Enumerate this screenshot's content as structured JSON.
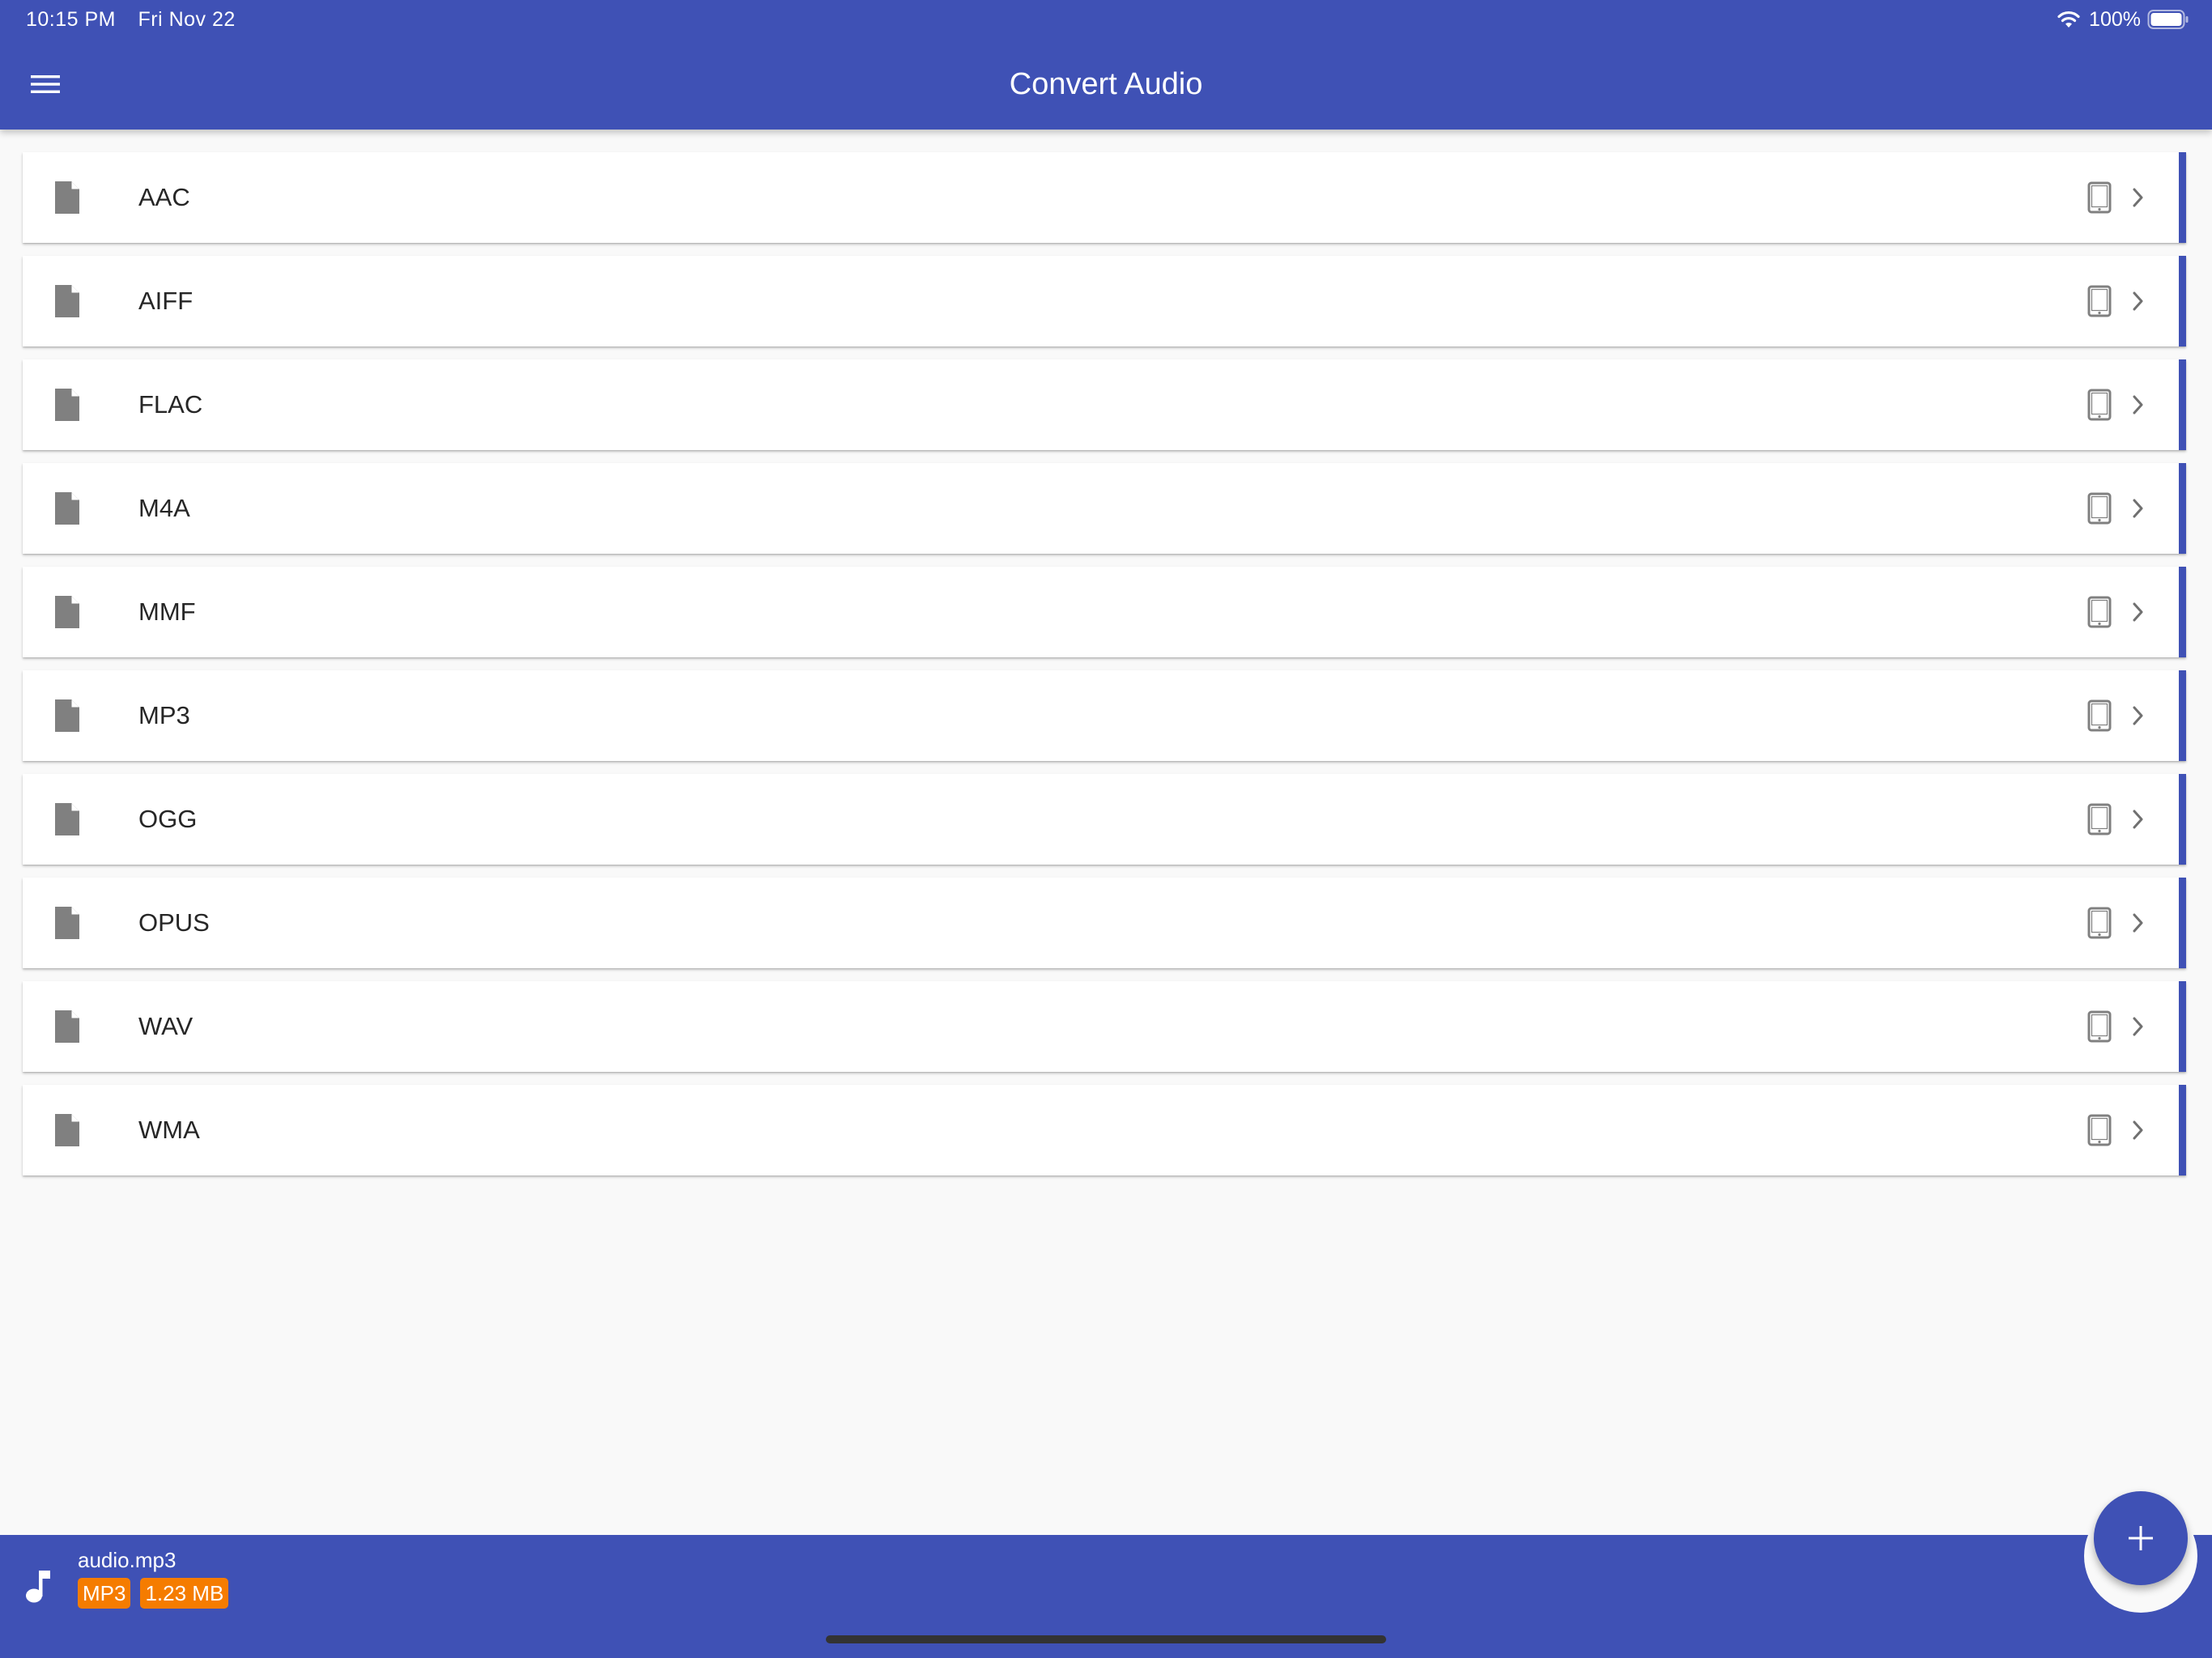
{
  "status_bar": {
    "time": "10:15 PM",
    "date": "Fri Nov 22",
    "battery": "100%"
  },
  "header": {
    "title": "Convert Audio",
    "menu_icon": "hamburger-menu-icon"
  },
  "formats": [
    {
      "label": "AAC"
    },
    {
      "label": "AIFF"
    },
    {
      "label": "FLAC"
    },
    {
      "label": "M4A"
    },
    {
      "label": "MMF"
    },
    {
      "label": "MP3"
    },
    {
      "label": "OGG"
    },
    {
      "label": "OPUS"
    },
    {
      "label": "WAV"
    },
    {
      "label": "WMA"
    }
  ],
  "row_icons": {
    "leading": "file-icon",
    "device": "tablet-icon",
    "trailing": "chevron-right-icon"
  },
  "current_file": {
    "name": "audio.mp3",
    "type_badge": "MP3",
    "size_badge": "1.23 MB",
    "icon": "music-note-icon"
  },
  "fab": {
    "icon": "plus-icon"
  },
  "colors": {
    "primary": "#3f51b5",
    "badge": "#f57c00",
    "background": "#f9f9f9",
    "row_background": "#ffffff",
    "icon_gray": "#808080"
  }
}
